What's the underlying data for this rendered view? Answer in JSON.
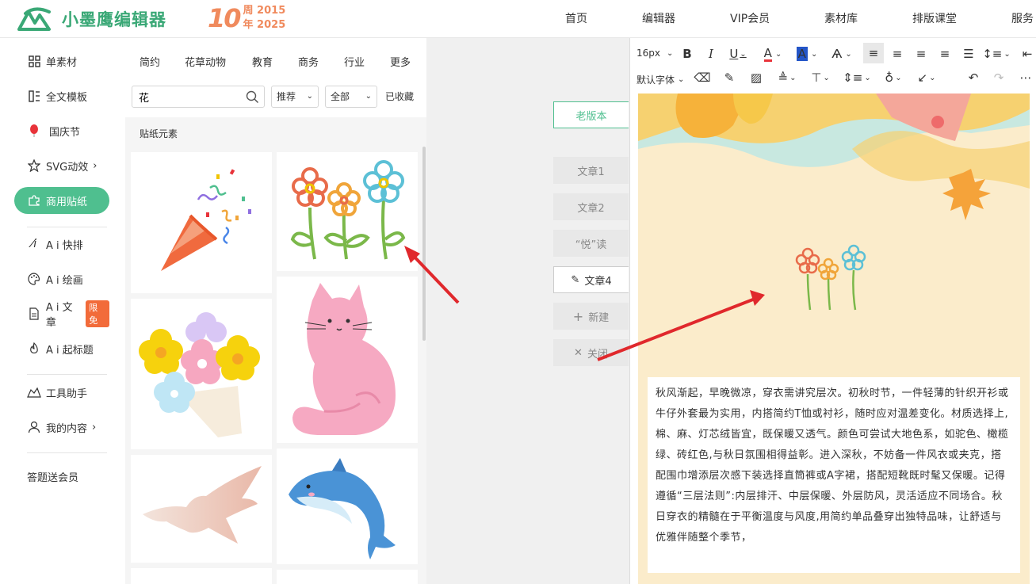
{
  "brand": {
    "name": "小墨鹰编辑器",
    "anniversary_num": "10",
    "anniversary_year1": "周 2015",
    "anniversary_year2": "年 2025"
  },
  "nav": [
    "首页",
    "编辑器",
    "VIP会员",
    "素材库",
    "排版课堂",
    "服务"
  ],
  "sidebar": {
    "items": [
      {
        "label": "单素材",
        "icon": "grid-icon"
      },
      {
        "label": "全文模板",
        "icon": "template-icon"
      },
      {
        "label": "国庆节",
        "icon": "balloon-icon"
      },
      {
        "label": "SVG动效",
        "icon": "star-icon"
      },
      {
        "label": "商用贴纸",
        "icon": "puzzle-icon"
      },
      {
        "label": "A i 快排",
        "icon": "ai-icon"
      },
      {
        "label": "A i 绘画",
        "icon": "palette-icon"
      },
      {
        "label": "A i 文章",
        "icon": "doc-icon",
        "badge": "限免"
      },
      {
        "label": "A i 起标题",
        "icon": "fire-icon"
      },
      {
        "label": "工具助手",
        "icon": "tool-icon"
      },
      {
        "label": "我的内容",
        "icon": "user-icon"
      },
      {
        "label": "答题送会员",
        "icon": ""
      }
    ]
  },
  "panel": {
    "categories": [
      "简约",
      "花草动物",
      "教育",
      "商务",
      "行业",
      "更多"
    ],
    "search_value": "花",
    "sort": "推荐",
    "filter": "全部",
    "favorites": "已收藏",
    "section": "贴纸元素"
  },
  "versions": {
    "old": "老版本",
    "articles": [
      "文章1",
      "文章2",
      "“悦”读",
      "文章4"
    ],
    "new": "新建",
    "close": "关闭"
  },
  "toolbar": {
    "font_size": "16px",
    "font_family": "默认字体"
  },
  "article_text": "秋风渐起，早晚微凉，穿衣需讲究层次。初秋时节，一件轻薄的针织开衫或牛仔外套最为实用，内搭简约T恤或衬衫，随时应对温差变化。材质选择上,棉、麻、灯芯绒皆宜，既保暖又透气。颜色可尝试大地色系，如驼色、橄榄绿、砖红色,与秋日氛围相得益彰。进入深秋，不妨备一件风衣或夹克，搭配围巾增添层次感下装选择直筒裤或A字裙，搭配短靴既时髦又保暖。记得遵循“三层法则”:内层排汗、中层保暖、外层防风，灵活适应不同场合。秋日穿衣的精髓在于平衡温度与风度,用简约单品叠穿出独特品味，让舒适与优雅伴随整个季节，",
  "colors": {
    "accent": "#4fbf8f",
    "brand": "#3aa876",
    "arrow": "#e0282c",
    "canvas_bg": "#fbeccb"
  }
}
